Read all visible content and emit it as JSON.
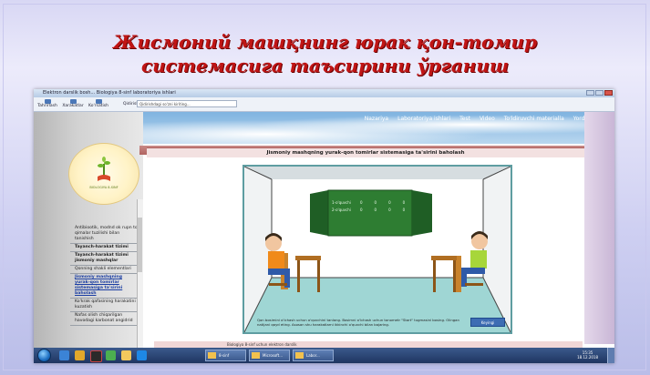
{
  "slide": {
    "title_line1": "Жисмоний машқнинг юрак қон-томир",
    "title_line2": "системасига таъсирини ўрганиш"
  },
  "window": {
    "title": "Elektron darslik bosh... Biologiya 8-sinf laboratoriya ishlari"
  },
  "toolbar": {
    "buttons": [
      {
        "label": "Tahrirlash",
        "icon": "hide-icon"
      },
      {
        "label": "Xarakatlar",
        "icon": "back-icon"
      },
      {
        "label": "Ko'rsatish",
        "icon": "forward-icon"
      }
    ],
    "address_label": "Qidirish:",
    "address_value": "Qidirishdagi so'zni kiriting..."
  },
  "nav": {
    "items": [
      "Nazariya",
      "Laboratoriya ishlari",
      "Test",
      "Video",
      "To'ldiruvchi materialla",
      "Yordam"
    ]
  },
  "logo": {
    "caption": "BIOLOGIYA 8-SINF"
  },
  "sidebar": {
    "items": [
      {
        "label": "Antibiootik, modnd ok rupn to' qimalar tuzilishi bilan tanishish",
        "style": "normal"
      },
      {
        "label": "Tayanch-harakat tizimi",
        "style": "bold"
      },
      {
        "label": "Tayanch-harakat tizimi jismoniy mashqlar",
        "style": "bold"
      },
      {
        "label": "Qonning shakli elementlari",
        "style": "normal"
      },
      {
        "label": "Jismoniy mashqning yurak-qon tomirlar sistemasiga ta'sirini baholash",
        "style": "selected"
      },
      {
        "label": "Ko'krak qafasining harakatini kuzatish",
        "style": "normal"
      },
      {
        "label": "Nafas olish chiqarilgan havodagi karbonat angidrid",
        "style": "normal"
      }
    ]
  },
  "content": {
    "header": "Jismoniy mashqning yurak-qon tomirlar sistemasiga ta'sirini baholash",
    "board_rows": [
      {
        "label": "1-o'quvchi",
        "cells": [
          "0",
          "0",
          "0",
          "0"
        ]
      },
      {
        "label": "2-o'quvchi",
        "cells": [
          "0",
          "0",
          "0",
          "0"
        ]
      }
    ],
    "instructions": "Qon bosimini o'lchash uchun o'quvchini tanlang. Bosimni o'lchash uchun tonometr \"Start\" tugmasini bosing. Olingan natijani qayd eting. Asosan shu harakatlarni ikkinchi o'quvchi bilan bajaring.",
    "next_button": "Keyingi"
  },
  "status": {
    "text": "Biologiya 8-sinf uchun elektron darslik"
  },
  "taskbar": {
    "pinned": [
      "ie-icon",
      "explorer-icon",
      "media-icon",
      "chrome-icon",
      "folder-icon",
      "play-icon"
    ],
    "tasks": [
      "8-sinf",
      "Microsoft...",
      "Labor..."
    ],
    "clock_time": "15:35",
    "clock_date": "18.12.2018"
  },
  "colors": {
    "title_red": "#c01515",
    "header_band": "#b06360",
    "board_green": "#2e7d32",
    "scene_wall": "#7cc2c2"
  }
}
